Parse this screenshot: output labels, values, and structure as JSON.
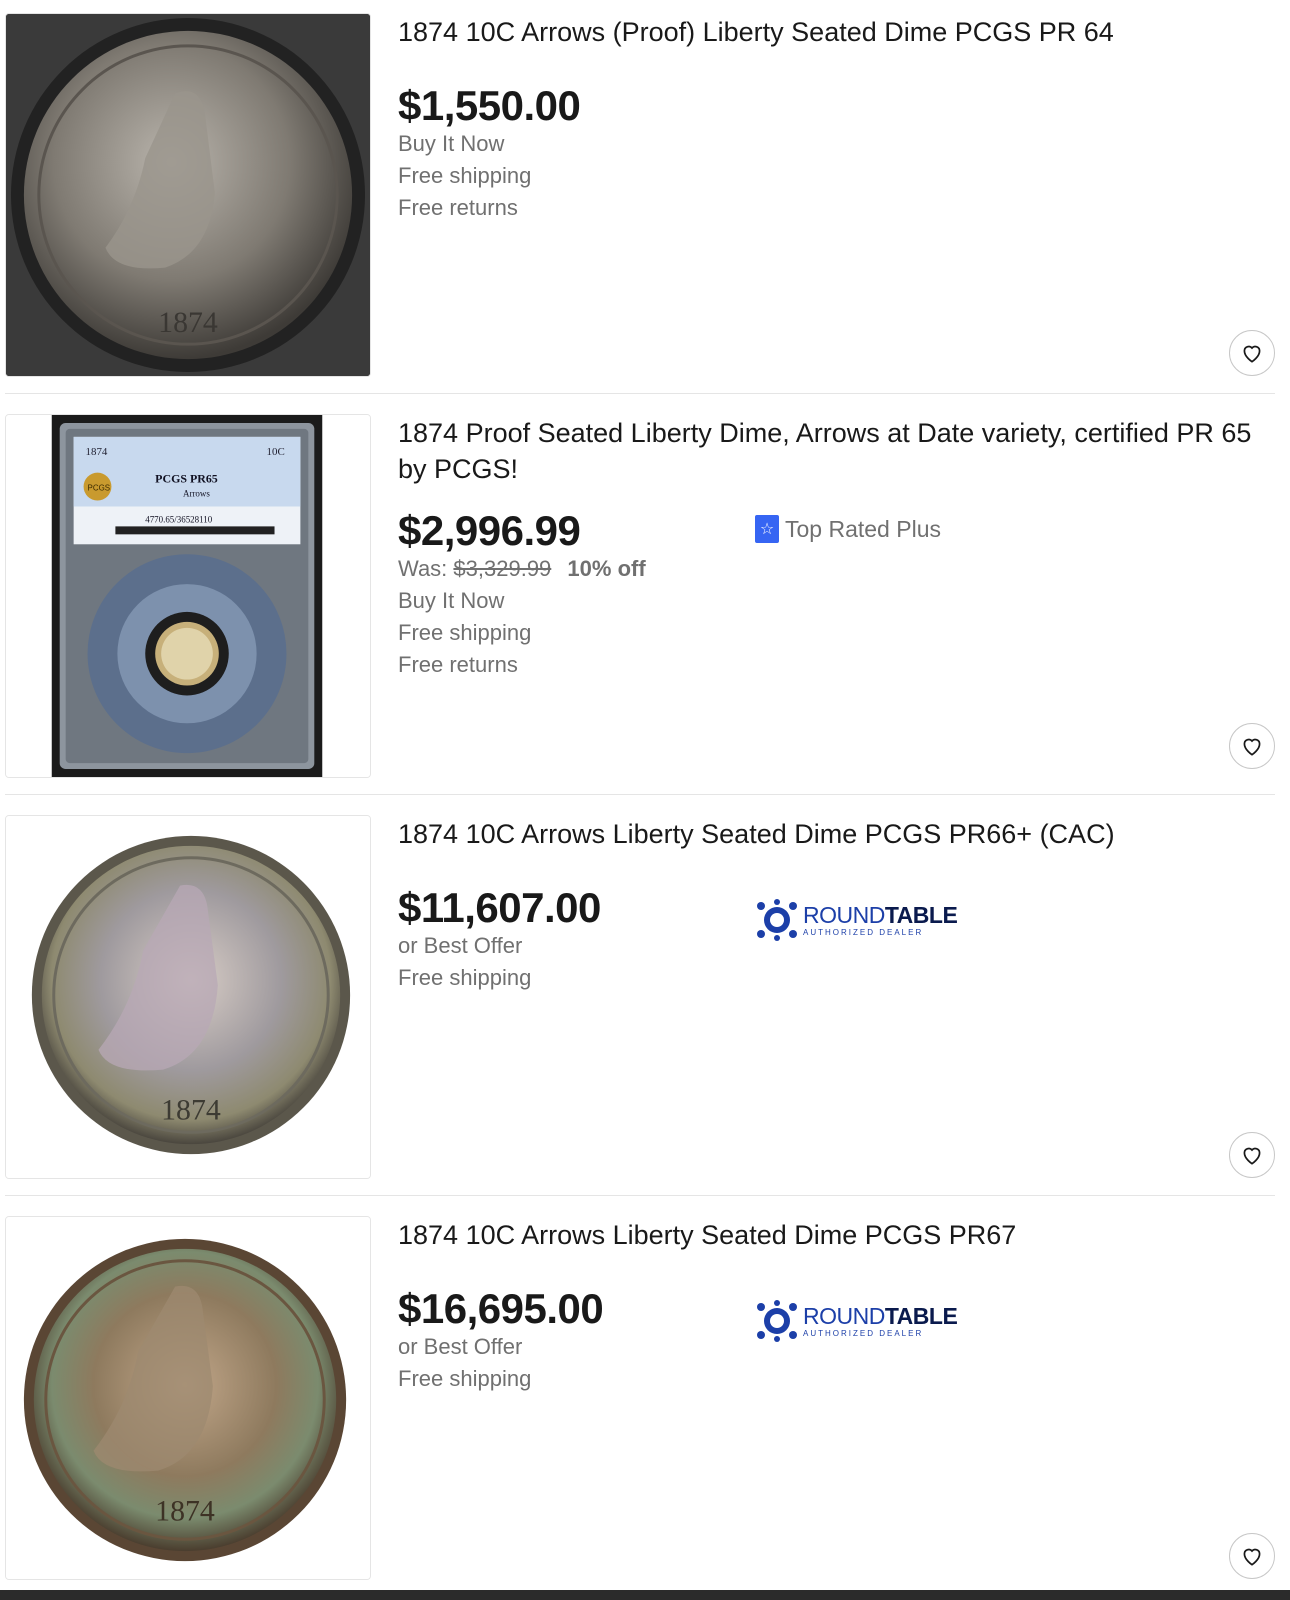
{
  "listings": [
    {
      "title": "1874 10C Arrows (Proof) Liberty Seated Dime PCGS PR 64",
      "price": "$1,550.00",
      "format": "Buy It Now",
      "shipping": "Free shipping",
      "returns": "Free returns",
      "watch_icon": "heart-icon"
    },
    {
      "title": "1874 Proof Seated Liberty Dime, Arrows at Date variety, certified PR 65 by PCGS!",
      "price": "$2,996.99",
      "was_label": "Was:",
      "was_price": "$3,329.99",
      "discount": "10% off",
      "format": "Buy It Now",
      "shipping": "Free shipping",
      "returns": "Free returns",
      "badge": "Top Rated Plus",
      "slab": {
        "year": "1874",
        "denom": "10C",
        "grade": "PCGS PR65",
        "variety": "Arrows",
        "cert": "4770.65/36528110",
        "logo": "PCGS"
      },
      "watch_icon": "heart-icon"
    },
    {
      "title": "1874 10C Arrows Liberty Seated Dime PCGS PR66+ (CAC)",
      "price": "$11,607.00",
      "format": "or Best Offer",
      "shipping": "Free shipping",
      "seller_logo": {
        "name_a": "ROUND",
        "name_b": "TABLE",
        "sub": "AUTHORIZED DEALER"
      },
      "watch_icon": "heart-icon"
    },
    {
      "title": "1874 10C Arrows Liberty Seated Dime PCGS PR67",
      "price": "$16,695.00",
      "format": "or Best Offer",
      "shipping": "Free shipping",
      "seller_logo": {
        "name_a": "ROUND",
        "name_b": "TABLE",
        "sub": "AUTHORIZED DEALER"
      },
      "watch_icon": "heart-icon"
    }
  ],
  "colors": {
    "text": "#191919",
    "secondary": "#707070",
    "badge_blue": "#3665f3",
    "roundtable_blue": "#1c3fa8"
  }
}
